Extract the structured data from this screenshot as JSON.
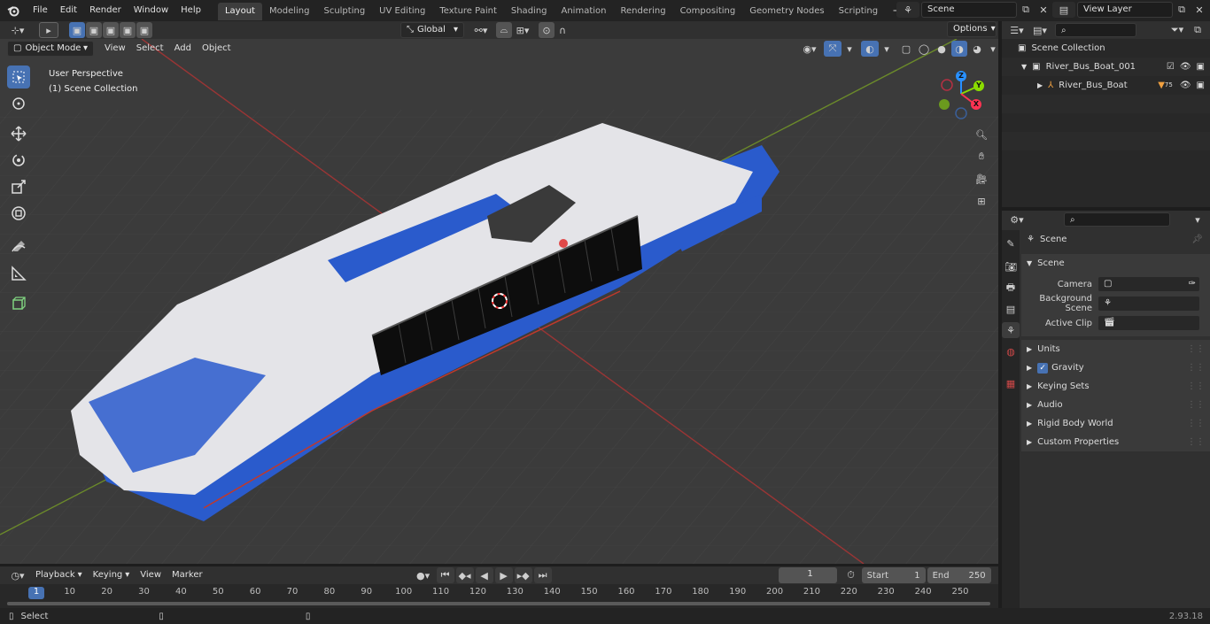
{
  "menu": [
    "File",
    "Edit",
    "Render",
    "Window",
    "Help"
  ],
  "workspaces": [
    {
      "label": "Layout",
      "active": true
    },
    {
      "label": "Modeling"
    },
    {
      "label": "Sculpting"
    },
    {
      "label": "UV Editing"
    },
    {
      "label": "Texture Paint"
    },
    {
      "label": "Shading"
    },
    {
      "label": "Animation"
    },
    {
      "label": "Rendering"
    },
    {
      "label": "Compositing"
    },
    {
      "label": "Geometry Nodes"
    },
    {
      "label": "Scripting"
    }
  ],
  "scene_field": "Scene",
  "view_layer_field": "View Layer",
  "viewport_header": {
    "mode": "Object Mode",
    "menus": [
      "View",
      "Select",
      "Add",
      "Object"
    ],
    "transform_orientation": "Global",
    "options": "Options"
  },
  "viewport_overlay": {
    "line1": "User Perspective",
    "line2": "(1) Scene Collection"
  },
  "gizmo": {
    "z": "Z",
    "y": "Y",
    "x": "X"
  },
  "outliner": {
    "root": "Scene Collection",
    "collection": "River_Bus_Boat_001",
    "object": "River_Bus_Boat",
    "modifier_count": "75"
  },
  "properties": {
    "header": "Scene",
    "section": "Scene",
    "fields": [
      {
        "label": "Camera",
        "value": ""
      },
      {
        "label": "Background Scene",
        "value": ""
      },
      {
        "label": "Active Clip",
        "value": ""
      }
    ],
    "panels": [
      {
        "label": "Units",
        "checkbox": false
      },
      {
        "label": "Gravity",
        "checkbox": true
      },
      {
        "label": "Keying Sets",
        "checkbox": false
      },
      {
        "label": "Audio",
        "checkbox": false
      },
      {
        "label": "Rigid Body World",
        "checkbox": false
      },
      {
        "label": "Custom Properties",
        "checkbox": false
      }
    ]
  },
  "timeline": {
    "menus": [
      "Playback",
      "Keying",
      "View",
      "Marker"
    ],
    "current_frame": "1",
    "start_label": "Start",
    "start_value": "1",
    "end_label": "End",
    "end_value": "250",
    "ruler": [
      "1",
      "10",
      "20",
      "30",
      "40",
      "50",
      "60",
      "70",
      "80",
      "90",
      "100",
      "110",
      "120",
      "130",
      "140",
      "150",
      "160",
      "170",
      "180",
      "190",
      "200",
      "210",
      "220",
      "230",
      "240",
      "250"
    ]
  },
  "status": {
    "select": "Select",
    "version": "2.93.18"
  },
  "colors": {
    "accent": "#4772b3",
    "x_axis": "#ff3352",
    "y_axis": "#8bdc00",
    "z_axis": "#2890ff",
    "boat_blue": "#2a5bcc",
    "boat_white": "#e4e4e8"
  }
}
